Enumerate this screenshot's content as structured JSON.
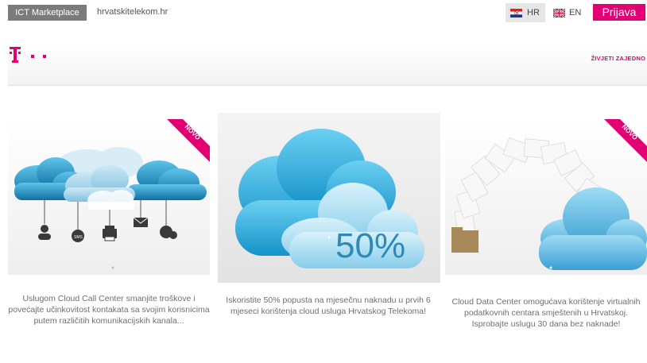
{
  "topbar": {
    "marketplace_label": "ICT Marketplace",
    "site_link": "hrvatskitelekom.hr",
    "lang_hr": "HR",
    "lang_en": "EN",
    "login_label": "Prijava"
  },
  "header": {
    "slogan": "ŽIVJETI ZAJEDNO"
  },
  "colors": {
    "brand_magenta": "#e20074",
    "marketplace_grey": "#7b7b7b"
  },
  "cards": [
    {
      "badge": "NOVO",
      "text": "Uslugom Cloud Call Center smanjite troškove i povećajte učinkovitost kontakata sa svojim korisnicima putem različitih komunikacijskih kanala..."
    },
    {
      "badge": "",
      "image_label": "50%",
      "text": "Iskoristite 50% popusta na mjesečnu naknadu u prvih 6 mjeseci korištenja cloud usluga Hrvatskog Telekoma!"
    },
    {
      "badge": "NOVO",
      "text": "Cloud Data Center omogućava korištenje virtualnih podatkovnih centara smještenih u Hrvatskoj. Isprobajte uslugu 30 dana bez naknade!"
    }
  ]
}
